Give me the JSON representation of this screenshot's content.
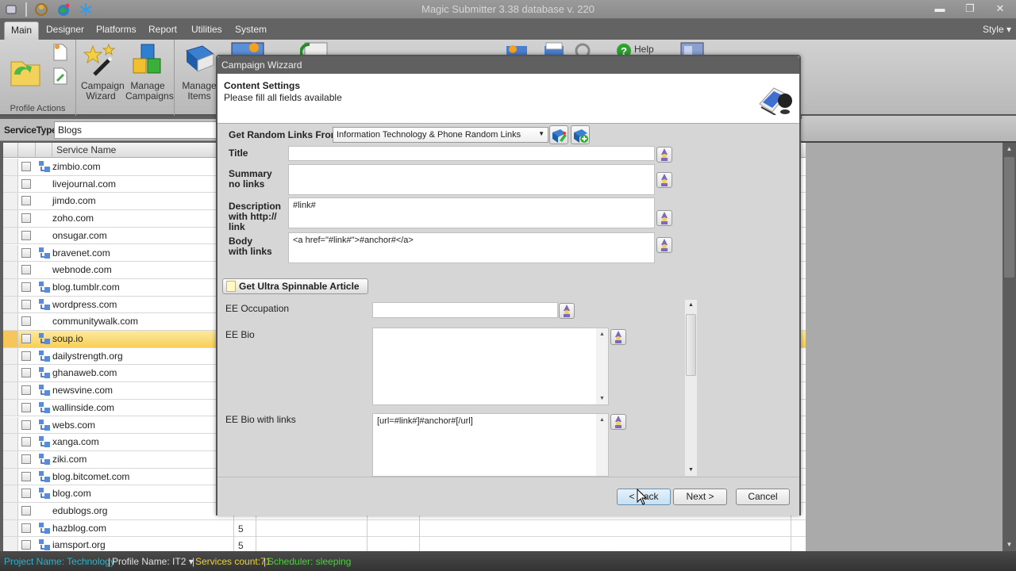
{
  "window": {
    "title": "Magic Submitter 3.38 database v. 220",
    "controls": {
      "minimize": "▬",
      "restore": "❐",
      "close": "✕"
    }
  },
  "menu": {
    "tabs": [
      "Main",
      "Designer",
      "Platforms",
      "Report",
      "Utilities",
      "System"
    ],
    "active": "Main",
    "style_label": "Style ▾"
  },
  "ribbon": {
    "profile_actions_label": "Profile Actions",
    "campaign_wizard": "Campaign\nWizard",
    "campaign_wizard_l1": "Campaign",
    "campaign_wizard_l2": "Wizard",
    "manage_campaigns_l1": "Manage",
    "manage_campaigns_l2": "Campaigns",
    "manage_items_l1": "Manage",
    "manage_items_l2": "Items",
    "help": "Help"
  },
  "filter": {
    "label": "ServiceType",
    "value": "Blogs"
  },
  "grid": {
    "columns": [
      "",
      "",
      "",
      "Service Name"
    ],
    "rows": [
      {
        "name": "zimbio.com",
        "icon": true,
        "num": ""
      },
      {
        "name": "livejournal.com",
        "icon": false,
        "num": ""
      },
      {
        "name": "jimdo.com",
        "icon": false,
        "num": ""
      },
      {
        "name": "zoho.com",
        "icon": false,
        "num": ""
      },
      {
        "name": "onsugar.com",
        "icon": false,
        "num": ""
      },
      {
        "name": "bravenet.com",
        "icon": true,
        "num": ""
      },
      {
        "name": "webnode.com",
        "icon": false,
        "num": ""
      },
      {
        "name": "blog.tumblr.com",
        "icon": true,
        "num": ""
      },
      {
        "name": "wordpress.com",
        "icon": true,
        "num": ""
      },
      {
        "name": "communitywalk.com",
        "icon": false,
        "num": ""
      },
      {
        "name": "soup.io",
        "icon": true,
        "num": "",
        "selected": true
      },
      {
        "name": "dailystrength.org",
        "icon": true,
        "num": ""
      },
      {
        "name": "ghanaweb.com",
        "icon": true,
        "num": ""
      },
      {
        "name": "newsvine.com",
        "icon": true,
        "num": ""
      },
      {
        "name": "wallinside.com",
        "icon": true,
        "num": ""
      },
      {
        "name": "webs.com",
        "icon": true,
        "num": ""
      },
      {
        "name": "xanga.com",
        "icon": true,
        "num": ""
      },
      {
        "name": "ziki.com",
        "icon": true,
        "num": ""
      },
      {
        "name": "blog.bitcomet.com",
        "icon": true,
        "num": ""
      },
      {
        "name": "blog.com",
        "icon": true,
        "num": ""
      },
      {
        "name": "edublogs.org",
        "icon": false,
        "num": ""
      },
      {
        "name": "hazblog.com",
        "icon": true,
        "num": "5"
      },
      {
        "name": "iamsport.org",
        "icon": true,
        "num": "5"
      }
    ]
  },
  "status": {
    "project": "Project Name: Technology",
    "profile": "Profile Name:  IT2  ▾",
    "services": "Services count:71",
    "scheduler": "Scheduler: sleeping",
    "colors": {
      "project": "#2fb0c8",
      "profile": "#e0e0e0",
      "services": "#e6d23a",
      "scheduler": "#4ccf3c"
    }
  },
  "dialog": {
    "title": "Campaign Wizzard",
    "header_title": "Content Settings",
    "header_subtitle": "Please fill all fields available",
    "random_links_label": "Get Random Links From:",
    "random_links_value": "Information Technology & Phone Random Links",
    "fields": {
      "title_label": "Title",
      "title_value": "",
      "summary_l1": "Summary",
      "summary_l2": "no links",
      "summary_value": "",
      "desc_l1": "Description",
      "desc_l2": "with http://",
      "desc_l3": "link",
      "desc_value": "#link#",
      "body_l1": "Body",
      "body_l2": "with links",
      "body_value": "<a href=\"#link#\">#anchor#</a>"
    },
    "spin_button": "Get Ultra Spinnable Article",
    "extra": {
      "occupation_label": "EE Occupation",
      "occupation_value": "",
      "bio_label": "EE Bio",
      "bio_value": "",
      "bio_links_label": "EE Bio with links",
      "bio_links_value": "[url=#link#]#anchor#[/url]"
    },
    "buttons": {
      "back": "< Back",
      "next": "Next >",
      "cancel": "Cancel"
    }
  }
}
